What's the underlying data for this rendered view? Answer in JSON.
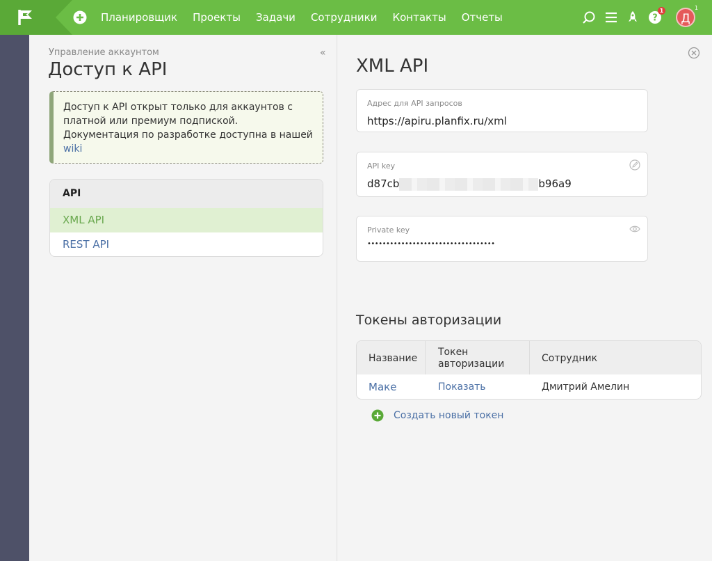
{
  "topbar": {
    "logo_icon": "flag-logo-icon",
    "add_icon": "plus-circle-icon",
    "nav": [
      {
        "label": "Планировщик"
      },
      {
        "label": "Проекты"
      },
      {
        "label": "Задачи"
      },
      {
        "label": "Сотрудники"
      },
      {
        "label": "Контакты"
      },
      {
        "label": "Отчеты"
      }
    ],
    "help_badge": "1",
    "avatar_badge": "1",
    "avatar_letter": "Д",
    "colors": {
      "bar": "#6bbd45",
      "logo_bg": "#5aa937",
      "avatar": "#e55a5a"
    }
  },
  "left": {
    "breadcrumb": "Управление аккаунтом",
    "title": "Доступ к API",
    "notice_text": "Доступ к API открыт только для аккаунтов с платной или премиум подпиской. Документация по разработке доступна в нашей ",
    "notice_link": "wiki",
    "menu_header": "API",
    "menu_items": [
      {
        "label": "XML API"
      },
      {
        "label": "REST API"
      }
    ]
  },
  "right": {
    "title": "XML API",
    "fields": [
      {
        "label": "Адрес для API запросов",
        "value": "https://apiru.planfix.ru/xml"
      },
      {
        "label": "API key",
        "value_start": "d87cb",
        "value_end": "b96a9"
      },
      {
        "label": "Private key",
        "value": "••••••••••••••••••••••••••••••••••"
      }
    ],
    "tokens_title": "Токены авторизации",
    "tokens_table": {
      "headers": [
        "Название",
        "Токен авторизации",
        "Сотрудник"
      ],
      "rows": [
        {
          "name": "Маке",
          "token": "Показать",
          "employee": "Дмитрий Амелин"
        }
      ]
    },
    "create_token": "Создать новый токен"
  }
}
